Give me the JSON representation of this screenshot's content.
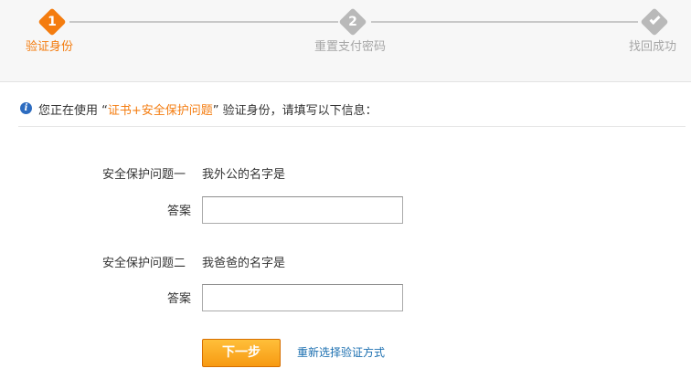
{
  "progress": {
    "steps": [
      {
        "number": "1",
        "label": "验证身份",
        "state": "active"
      },
      {
        "number": "2",
        "label": "重置支付密码",
        "state": "pending"
      },
      {
        "label": "找回成功",
        "state": "pending",
        "icon": "check-icon"
      }
    ]
  },
  "notice": {
    "icon": "info-icon",
    "icon_glyph": "i",
    "prefix": "您正在使用 “",
    "highlight": "证书+安全保护问题",
    "suffix": "” 验证身份，请填写以下信息："
  },
  "form": {
    "question1": {
      "label": "安全保护问题一",
      "text": "我外公的名字是"
    },
    "answer1": {
      "label": "答案",
      "value": ""
    },
    "question2": {
      "label": "安全保护问题二",
      "text": "我爸爸的名字是"
    },
    "answer2": {
      "label": "答案",
      "value": ""
    },
    "next_button": "下一步",
    "reselect_link": "重新选择验证方式"
  },
  "colors": {
    "accent": "#f47c0f",
    "inactive": "#b9b9b9",
    "link": "#1b6fb0",
    "info": "#2d6cc0"
  }
}
